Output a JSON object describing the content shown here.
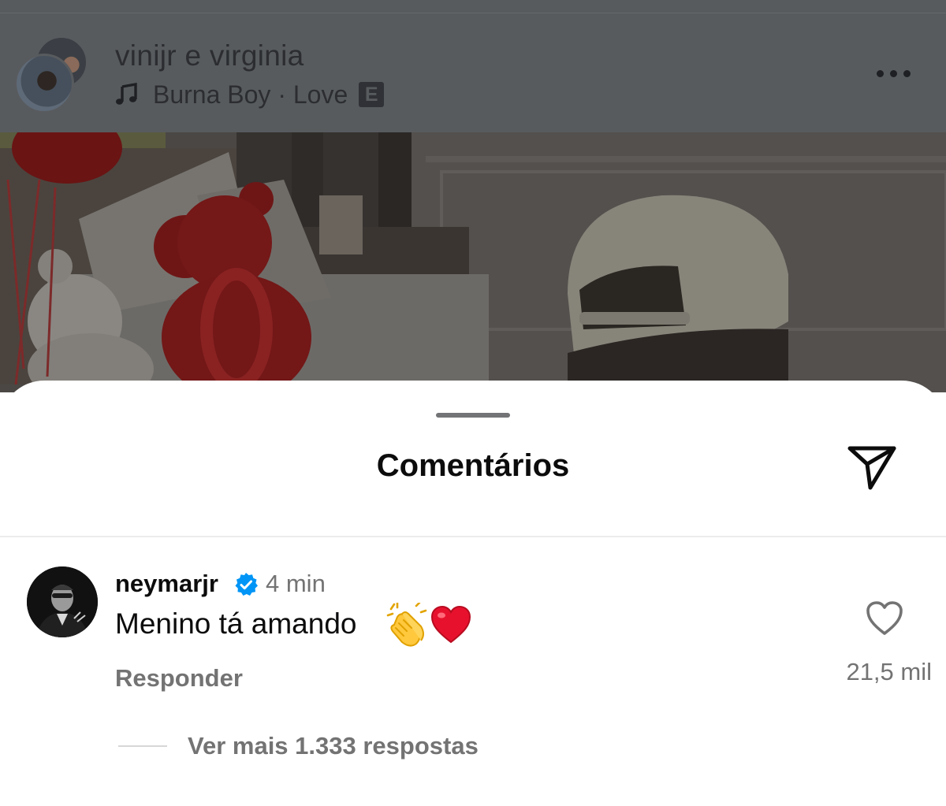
{
  "post": {
    "title": "vinijr e virginia",
    "music": "Burna Boy · Love",
    "explicit_badge": "E",
    "more_icon": "more-horizontal-icon"
  },
  "sheet": {
    "title": "Comentários",
    "share_icon": "paper-plane-icon"
  },
  "comment": {
    "username": "neymarjr",
    "verified": true,
    "time": "4 min",
    "text": "Menino tá amando",
    "emojis": [
      "clapping-hands",
      "red-heart"
    ],
    "reply_label": "Responder",
    "likes": "21,5 mil",
    "view_replies": "Ver mais 1.333 respostas"
  },
  "colors": {
    "dim_overlay": "#585b5e",
    "text_primary": "#0c0c0d",
    "text_secondary": "#737373",
    "verified_blue": "#0095f6",
    "sheet_bg": "#ffffff"
  }
}
